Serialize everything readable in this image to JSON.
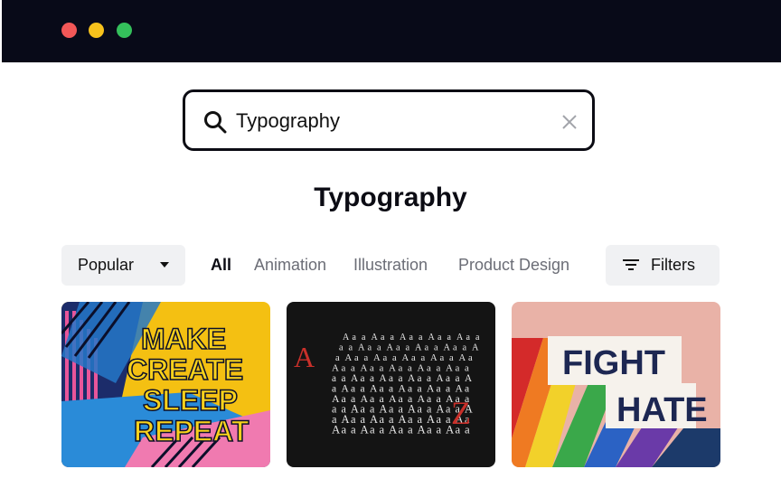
{
  "window": {
    "controls": [
      "close",
      "minimize",
      "maximize"
    ]
  },
  "search": {
    "value": "Typography",
    "icon": "search-icon",
    "clear_icon": "close-icon"
  },
  "page": {
    "title": "Typography"
  },
  "sort": {
    "label": "Popular",
    "icon": "chevron-down-icon"
  },
  "tabs": [
    {
      "label": "All",
      "active": true
    },
    {
      "label": "Animation",
      "active": false
    },
    {
      "label": "Illustration",
      "active": false
    },
    {
      "label": "Product Design",
      "active": false
    }
  ],
  "filters": {
    "label": "Filters",
    "icon": "filter-icon"
  },
  "cards": [
    {
      "lines": [
        "MAKE",
        "CREATE",
        "SLEEP",
        "REPEAT"
      ]
    },
    {
      "letters": [
        "A",
        "Z"
      ],
      "pattern_glyphs": [
        "a",
        "A"
      ]
    },
    {
      "lines": [
        "FIGHT",
        "HATE"
      ]
    }
  ],
  "colors": {
    "titlebar": "#080a18",
    "close": "#f25757",
    "minimize": "#f7c21c",
    "maximize": "#34c05b",
    "chip_bg": "#f0f1f3",
    "tab_inactive": "#6b6d76"
  }
}
